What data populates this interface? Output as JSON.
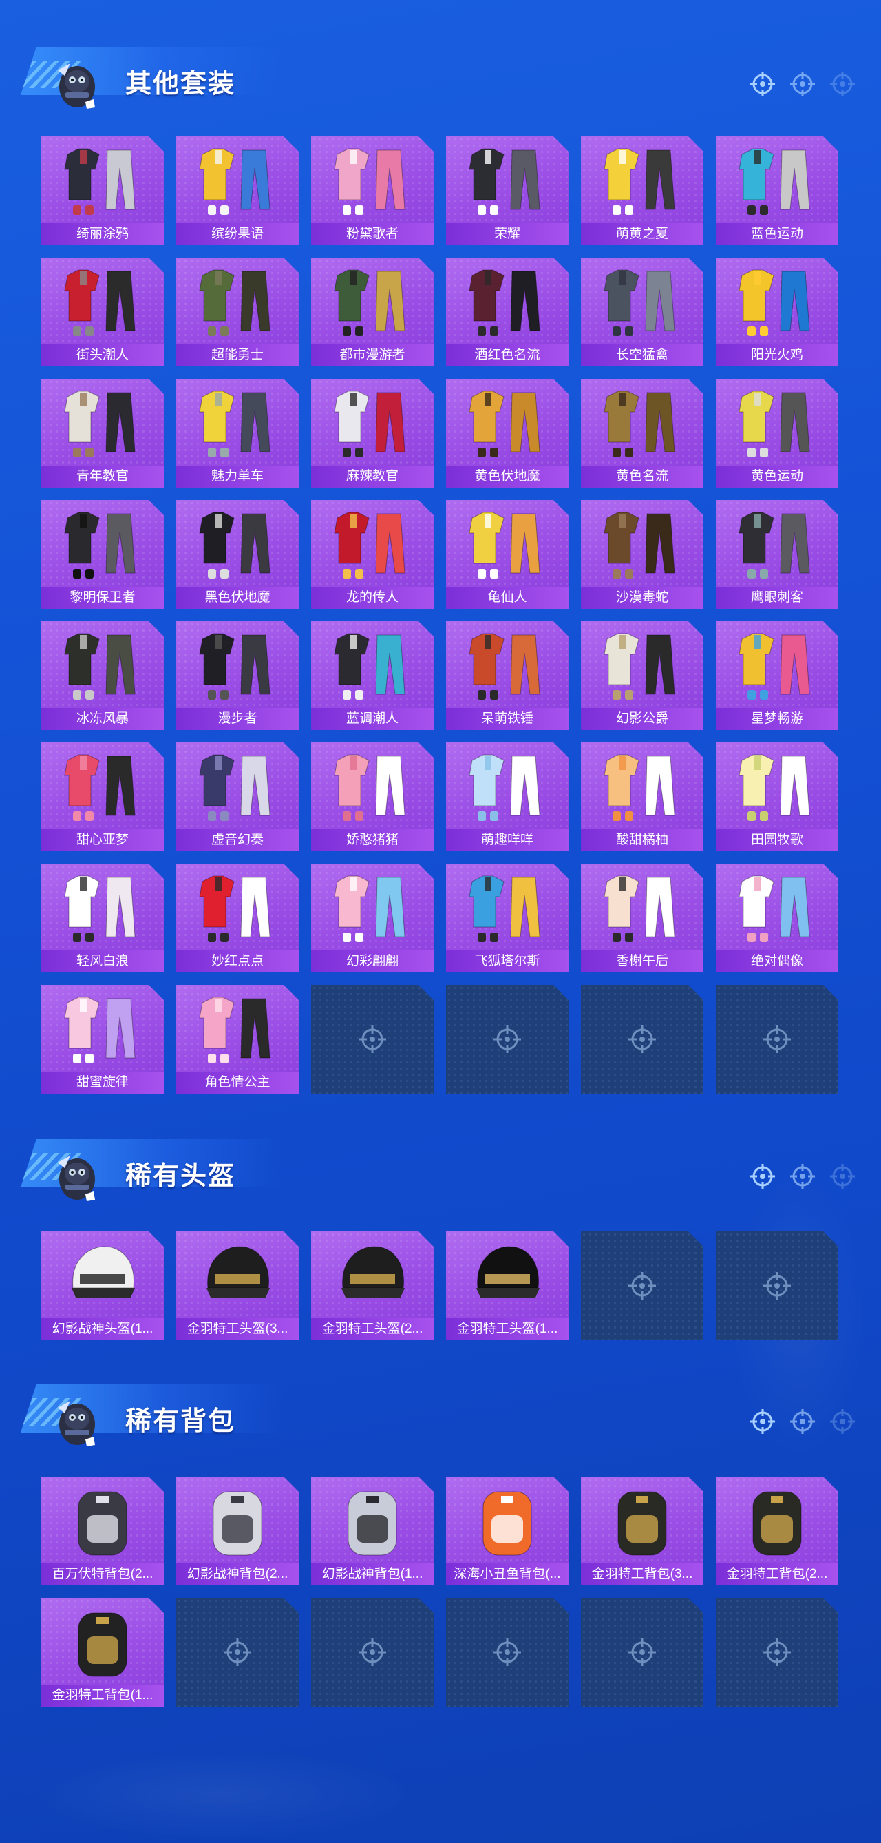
{
  "colors": {
    "accent": "#9b4fe6",
    "label_bg": "#7b2fd8",
    "empty_slot": "#1f3f78",
    "background": "#1452d6"
  },
  "sections": [
    {
      "title": "其他套装",
      "items": [
        {
          "label": "绮丽涂鸦",
          "icon": "outfit-dark-jacket-icon"
        },
        {
          "label": "缤纷果语",
          "icon": "outfit-yellow-fruit-icon"
        },
        {
          "label": "粉黛歌者",
          "icon": "outfit-pink-singer-icon"
        },
        {
          "label": "荣耀",
          "icon": "outfit-black-jacket-icon"
        },
        {
          "label": "萌黄之夏",
          "icon": "outfit-yellow-summer-icon"
        },
        {
          "label": "蓝色运动",
          "icon": "outfit-blue-sport-icon"
        },
        {
          "label": "街头潮人",
          "icon": "outfit-red-puffer-icon"
        },
        {
          "label": "超能勇士",
          "icon": "outfit-olive-vest-icon"
        },
        {
          "label": "都市漫游者",
          "icon": "outfit-green-hoodie-icon"
        },
        {
          "label": "酒红色名流",
          "icon": "outfit-wine-suit-icon"
        },
        {
          "label": "长空猛禽",
          "icon": "outfit-camo-jacket-icon"
        },
        {
          "label": "阳光火鸡",
          "icon": "outfit-yellow-hat-icon"
        },
        {
          "label": "青年教官",
          "icon": "outfit-white-shirt-icon"
        },
        {
          "label": "魅力单车",
          "icon": "outfit-yellow-shirt-icon"
        },
        {
          "label": "麻辣教官",
          "icon": "outfit-red-white-icon"
        },
        {
          "label": "黄色伏地魔",
          "icon": "outfit-yellow-ghillie-icon"
        },
        {
          "label": "黄色名流",
          "icon": "outfit-brown-suit-icon"
        },
        {
          "label": "黄色运动",
          "icon": "outfit-yellow-sport-icon"
        },
        {
          "label": "黎明保卫者",
          "icon": "outfit-black-leather-icon"
        },
        {
          "label": "黑色伏地魔",
          "icon": "outfit-black-ghillie-icon"
        },
        {
          "label": "龙的传人",
          "icon": "outfit-red-dress-icon"
        },
        {
          "label": "龟仙人",
          "icon": "outfit-hawaiian-shirt-icon"
        },
        {
          "label": "沙漠毒蛇",
          "icon": "outfit-desert-icon"
        },
        {
          "label": "鹰眼刺客",
          "icon": "outfit-plague-mask-icon"
        },
        {
          "label": "冰冻风暴",
          "icon": "outfit-tactical-icon"
        },
        {
          "label": "漫步者",
          "icon": "outfit-black-suit-icon"
        },
        {
          "label": "蓝调潮人",
          "icon": "outfit-blue-mask-icon"
        },
        {
          "label": "呆萌铁锤",
          "icon": "outfit-bear-head-icon"
        },
        {
          "label": "幻影公爵",
          "icon": "outfit-white-coat-icon"
        },
        {
          "label": "星梦畅游",
          "icon": "outfit-colorful-icon"
        },
        {
          "label": "甜心亚梦",
          "icon": "outfit-red-pink-icon"
        },
        {
          "label": "虚音幻奏",
          "icon": "outfit-striped-icon"
        },
        {
          "label": "娇憨猪猪",
          "icon": "outfit-pink-pig-icon"
        },
        {
          "label": "萌趣咩咩",
          "icon": "outfit-sheep-icon"
        },
        {
          "label": "酸甜橘柚",
          "icon": "outfit-orange-icon"
        },
        {
          "label": "田园牧歌",
          "icon": "outfit-pastoral-icon"
        },
        {
          "label": "轻风白浪",
          "icon": "outfit-white-dress-icon"
        },
        {
          "label": "妙红点点",
          "icon": "outfit-red-dots-icon"
        },
        {
          "label": "幻彩翩翩",
          "icon": "outfit-pastel-icon"
        },
        {
          "label": "飞狐塔尔斯",
          "icon": "outfit-blue-fox-icon"
        },
        {
          "label": "香榭午后",
          "icon": "outfit-cream-icon"
        },
        {
          "label": "绝对偶像",
          "icon": "outfit-idol-icon"
        },
        {
          "label": "甜蜜旋律",
          "icon": "outfit-sweet-icon"
        },
        {
          "label": "角色情公主",
          "icon": "character-pink-princess-icon"
        }
      ],
      "empty_slots": 4
    },
    {
      "title": "稀有头盔",
      "items": [
        {
          "label": "幻影战神头盔(1...",
          "icon": "helmet-white-icon"
        },
        {
          "label": "金羽特工头盔(3...",
          "icon": "helmet-level3-icon"
        },
        {
          "label": "金羽特工头盔(2...",
          "icon": "helmet-level2-icon"
        },
        {
          "label": "金羽特工头盔(1...",
          "icon": "helmet-level1-icon"
        }
      ],
      "empty_slots": 2
    },
    {
      "title": "稀有背包",
      "items": [
        {
          "label": "百万伏特背包(2...",
          "icon": "backpack-volt-icon"
        },
        {
          "label": "幻影战神背包(2...",
          "icon": "backpack-phantom2-icon"
        },
        {
          "label": "幻影战神背包(1...",
          "icon": "backpack-phantom1-icon"
        },
        {
          "label": "深海小丑鱼背包(...",
          "icon": "backpack-clownfish-icon"
        },
        {
          "label": "金羽特工背包(3...",
          "icon": "backpack-gold3-icon"
        },
        {
          "label": "金羽特工背包(2...",
          "icon": "backpack-gold2-icon"
        },
        {
          "label": "金羽特工背包(1...",
          "icon": "backpack-gold1-icon"
        }
      ],
      "empty_slots": 5
    }
  ]
}
